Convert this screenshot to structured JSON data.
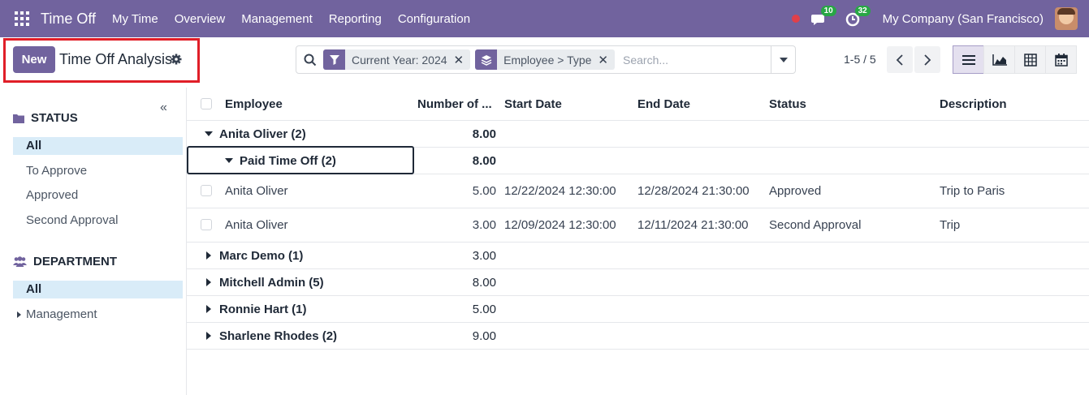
{
  "navbar": {
    "app_title": "Time Off",
    "menu": [
      "My Time",
      "Overview",
      "Management",
      "Reporting",
      "Configuration"
    ],
    "messages_count": "10",
    "activities_count": "32",
    "company": "My Company (San Francisco)"
  },
  "control": {
    "new_label": "New",
    "page_title": "Time Off Analysis",
    "facets": [
      {
        "icon": "filter-icon",
        "label": "Current Year: 2024"
      },
      {
        "icon": "group-by-icon",
        "label": "Employee > Type"
      }
    ],
    "search_placeholder": "Search...",
    "pager": "1-5 / 5",
    "views": [
      "list-view-icon",
      "graph-view-icon",
      "pivot-view-icon",
      "calendar-view-icon"
    ]
  },
  "sidebar": {
    "status": {
      "title": "STATUS",
      "items": [
        "All",
        "To Approve",
        "Approved",
        "Second Approval"
      ]
    },
    "department": {
      "title": "DEPARTMENT",
      "items": [
        "All",
        "Management"
      ]
    }
  },
  "table": {
    "columns": [
      "Employee",
      "Number of ...",
      "Start Date",
      "End Date",
      "Status",
      "Description"
    ],
    "groups": [
      {
        "label": "Anita Oliver (2)",
        "total": "8.00",
        "expanded": true,
        "subgroup": {
          "label": "Paid Time Off (2)",
          "total": "8.00"
        },
        "records": [
          {
            "employee": "Anita Oliver",
            "days": "5.00",
            "start": "12/22/2024 12:30:00",
            "end": "12/28/2024 21:30:00",
            "status": "Approved",
            "description": "Trip to Paris"
          },
          {
            "employee": "Anita Oliver",
            "days": "3.00",
            "start": "12/09/2024 12:30:00",
            "end": "12/11/2024 21:30:00",
            "status": "Second Approval",
            "description": "Trip"
          }
        ]
      },
      {
        "label": "Marc Demo (1)",
        "total": "3.00"
      },
      {
        "label": "Mitchell Admin (5)",
        "total": "8.00"
      },
      {
        "label": "Ronnie Hart (1)",
        "total": "5.00"
      },
      {
        "label": "Sharlene Rhodes (2)",
        "total": "9.00"
      }
    ]
  },
  "colors": {
    "brand": "#71639e",
    "highlight": "#e01e28",
    "active_filter": "#d9ecf8"
  }
}
